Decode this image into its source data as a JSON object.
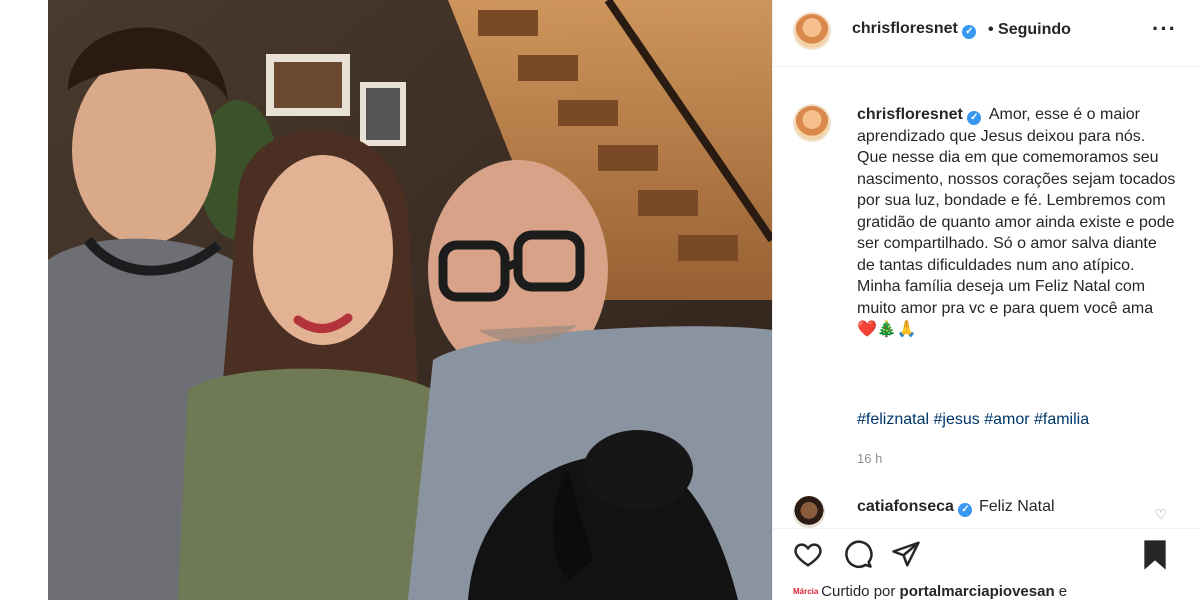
{
  "post": {
    "author": "chrisfloresnet",
    "follow_status": "Seguindo",
    "more_icon": "more-options-icon",
    "caption_text": "Amor, esse é o maior aprendizado que Jesus deixou para nós. Que nesse dia em que comemoramos seu nascimento, nossos corações sejam tocados por sua luz, bondade e fé. Lembremos com gratidão de quanto amor ainda existe e pode ser compartilhado. Só o amor salva diante de tantas dificuldades num ano atípico. Minha família deseja um Feliz Natal com muito amor pra vc e para quem você ama ❤️🎄🙏",
    "hashtags": "#feliznatal #jesus #amor #familia",
    "timestamp": "16 h"
  },
  "comment": {
    "author": "catiafonseca",
    "text": "Feliz Natal"
  },
  "likes": {
    "prefix": "Curtido por",
    "user": "portalmarciapiovesan",
    "suffix": "e",
    "mini_logo": "Márcia"
  },
  "colors": {
    "verified": "#3897f0",
    "hashtag": "#00376b",
    "muted": "#8e8e8e"
  }
}
